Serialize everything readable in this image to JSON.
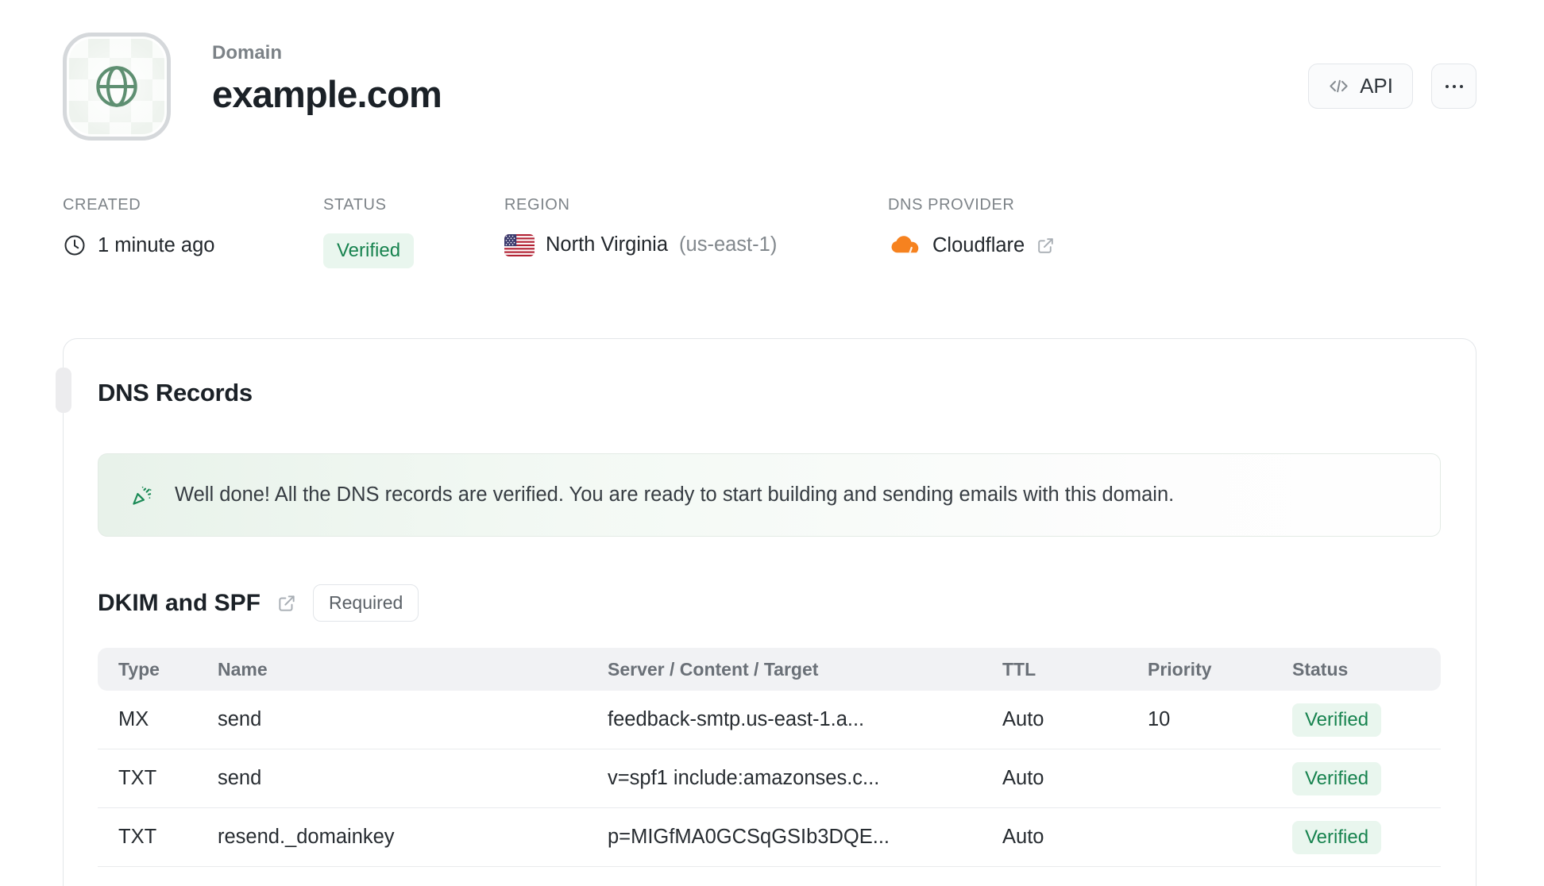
{
  "header": {
    "kicker": "Domain",
    "domain": "example.com",
    "api_button_label": "API"
  },
  "meta": {
    "created": {
      "label": "CREATED",
      "value": "1 minute ago"
    },
    "status": {
      "label": "STATUS",
      "value": "Verified"
    },
    "region": {
      "label": "REGION",
      "value": "North Virginia",
      "code": "(us-east-1)"
    },
    "dns_provider": {
      "label": "DNS PROVIDER",
      "value": "Cloudflare"
    }
  },
  "dns_card": {
    "title": "DNS Records",
    "banner_message": "Well done! All the DNS records are verified. You are ready to start building and sending emails with this domain.",
    "section": {
      "title": "DKIM and SPF",
      "badge": "Required"
    },
    "table": {
      "headers": [
        "Type",
        "Name",
        "Server / Content / Target",
        "TTL",
        "Priority",
        "Status"
      ],
      "rows": [
        {
          "type": "MX",
          "name": "send",
          "content": "feedback-smtp.us-east-1.a...",
          "ttl": "Auto",
          "priority": "10",
          "status": "Verified"
        },
        {
          "type": "TXT",
          "name": "send",
          "content": "v=spf1 include:amazonses.c...",
          "ttl": "Auto",
          "priority": "",
          "status": "Verified"
        },
        {
          "type": "TXT",
          "name": "resend._domainkey",
          "content": "p=MIGfMA0GCSqGSIb3DQE...",
          "ttl": "Auto",
          "priority": "",
          "status": "Verified"
        }
      ]
    }
  },
  "icons": {
    "globe-icon": "green globe outline",
    "code-icon": "</>",
    "ellipsis-icon": "...",
    "clock-icon": "clock outline",
    "us-flag-icon": "US flag",
    "cloudflare-icon": "orange cloud",
    "external-link-icon": "box with arrow",
    "party-popper-icon": "green confetti"
  },
  "colors": {
    "accent_green": "#17834f",
    "badge_green_bg": "#e9f6ee",
    "banner_green_bg": "#e8f2ea",
    "globe_green": "#5e8f71",
    "cloudflare_orange": "#f6821f",
    "cloudflare_orange_light": "#fbad41",
    "flag_red": "#b22234",
    "flag_blue": "#3c3b6e",
    "text_dark": "#1b2127",
    "text_gray": "#7d8388",
    "border": "#e3e6e9",
    "table_header_bg": "#f1f2f4"
  }
}
